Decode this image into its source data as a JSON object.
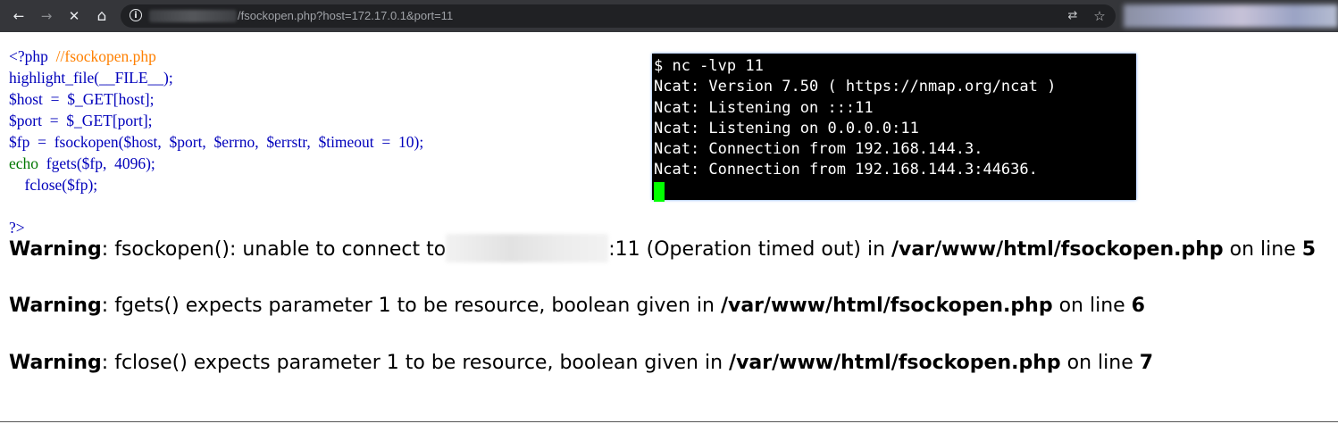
{
  "browser": {
    "back_icon": "←",
    "forward_icon": "→",
    "stop_icon": "✕",
    "home_icon": "⌂",
    "info_icon": "i",
    "url_path": "/fsockopen.php?host=172.17.0.1&port=11",
    "translate_icon": "⇄",
    "bookmark_icon": "☆"
  },
  "source": {
    "open_tag": "<?php",
    "comment": "//fsockopen.php",
    "line2": "highlight_file(__FILE__);",
    "line3": "$host  =  $_GET[host];",
    "line4": "$port  =  $_GET[port];",
    "line5": "$fp  =  fsockopen($host,  $port,  $errno,  $errstr,  $timeout  =  10);",
    "line6_kw": "echo",
    "line6_rest": "  fgets($fp,  4096);",
    "line7": "    fclose($fp);",
    "close_tag": "?>"
  },
  "terminal": {
    "lines": [
      "$ nc -lvp 11",
      "Ncat: Version 7.50 ( https://nmap.org/ncat )",
      "Ncat: Listening on :::11",
      "Ncat: Listening on 0.0.0.0:11",
      "Ncat: Connection from 192.168.144.3.",
      "Ncat: Connection from 192.168.144.3:44636."
    ]
  },
  "warnings": [
    {
      "label": "Warning",
      "pre": ": fsockopen(): unable to connect to",
      "post": ":11 (Operation timed out) in ",
      "file": "/var/www/html/fsockopen.php",
      "on_line": " on line ",
      "line": "5"
    },
    {
      "label": "Warning",
      "message": ": fgets() expects parameter 1 to be resource, boolean given in ",
      "file": "/var/www/html/fsockopen.php",
      "on_line": " on line ",
      "line": "6"
    },
    {
      "label": "Warning",
      "message": ": fclose() expects parameter 1 to be resource, boolean given in ",
      "file": "/var/www/html/fsockopen.php",
      "on_line": " on line ",
      "line": "7"
    }
  ]
}
